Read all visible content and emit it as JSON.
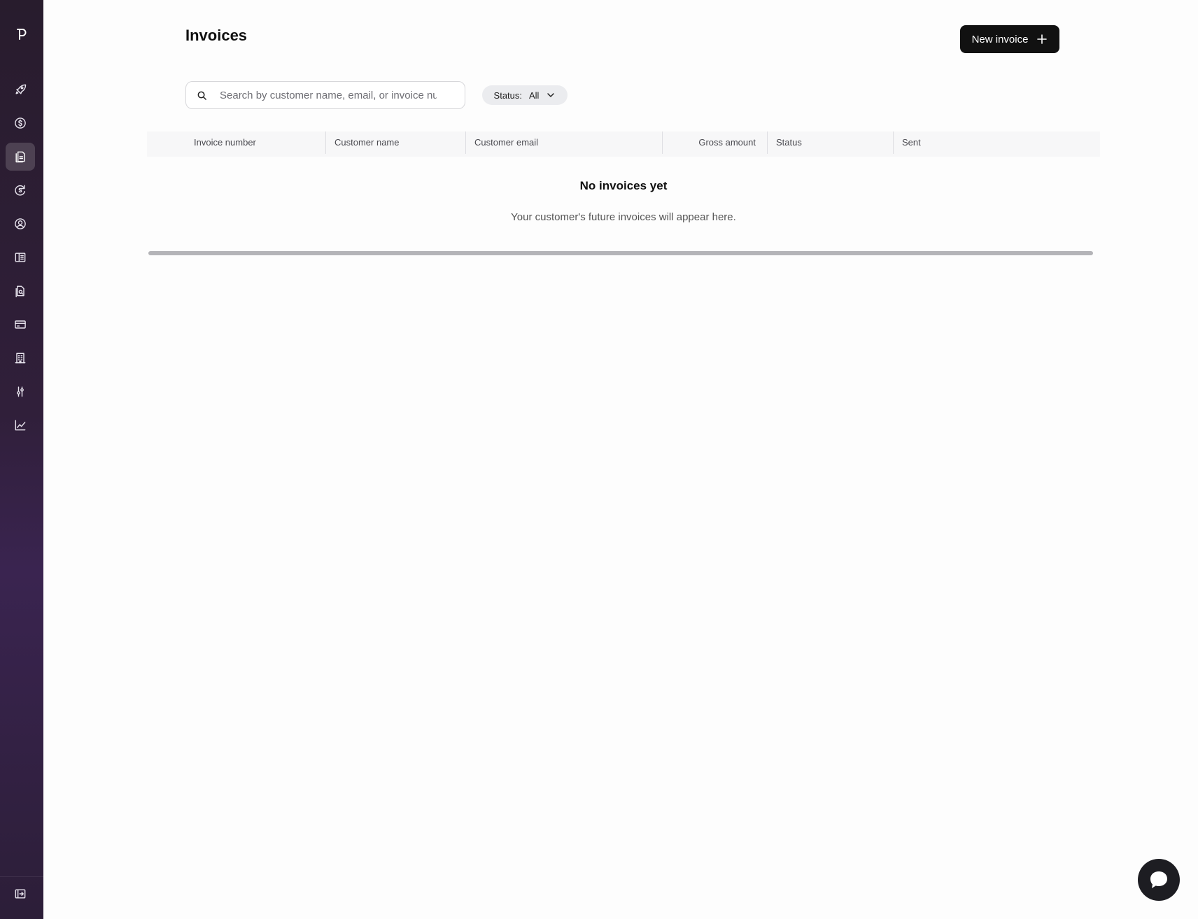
{
  "page": {
    "title": "Invoices",
    "new_invoice_label": "New invoice"
  },
  "search": {
    "placeholder": "Search by customer name, email, or invoice number",
    "value": ""
  },
  "status_filter": {
    "label": "Status:",
    "value": "All"
  },
  "table": {
    "columns": [
      "Invoice number",
      "Customer name",
      "Customer email",
      "Gross amount",
      "Status",
      "Sent"
    ]
  },
  "empty_state": {
    "title": "No invoices yet",
    "subtitle": "Your customer's future invoices will appear here."
  },
  "sidebar": {
    "items": [
      {
        "icon": "rocket-icon"
      },
      {
        "icon": "dollar-circle-icon"
      },
      {
        "icon": "invoice-icon",
        "active": true
      },
      {
        "icon": "recurring-payment-icon"
      },
      {
        "icon": "user-circle-icon"
      },
      {
        "icon": "book-icon"
      },
      {
        "icon": "file-search-icon"
      },
      {
        "icon": "credit-card-icon"
      },
      {
        "icon": "building-icon"
      },
      {
        "icon": "sliders-icon"
      },
      {
        "icon": "chart-icon"
      }
    ],
    "bottom": {
      "icon": "collapse-sidebar-icon"
    }
  },
  "colors": {
    "sidebar_top": "#281c2d",
    "sidebar_mid": "#3a2450",
    "primary_button": "#111111",
    "chip": "#ebecef"
  }
}
